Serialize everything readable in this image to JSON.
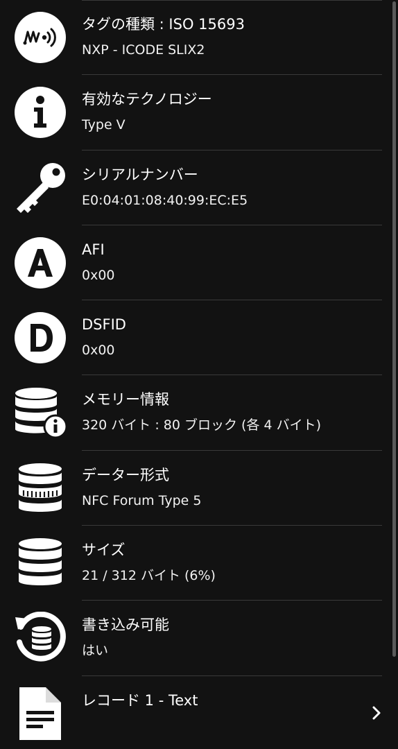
{
  "rows": [
    {
      "icon": "nfc-signal-icon",
      "title": "タグの種類 : ISO 15693",
      "value": "NXP - ICODE SLIX2"
    },
    {
      "icon": "info-icon",
      "title": "有効なテクノロジー",
      "value": "Type V"
    },
    {
      "icon": "key-icon",
      "title": "シリアルナンバー",
      "value": "E0:04:01:08:40:99:EC:E5"
    },
    {
      "icon": "letter-a-icon",
      "title": "AFI",
      "value": "0x00"
    },
    {
      "icon": "letter-d-icon",
      "title": "DSFID",
      "value": "0x00"
    },
    {
      "icon": "database-info-icon",
      "title": "メモリー情報",
      "value": "320 バイト : 80 ブロック (各 4 バイト)"
    },
    {
      "icon": "database-format-icon",
      "title": "データー形式",
      "value": "NFC Forum Type 5"
    },
    {
      "icon": "database-icon",
      "title": "サイズ",
      "value": "21 / 312 バイト (6%)"
    },
    {
      "icon": "database-refresh-icon",
      "title": "書き込み可能",
      "value": "はい"
    },
    {
      "icon": "document-icon",
      "title": "レコード 1 - Text",
      "value": ""
    }
  ],
  "colors": {
    "background": "#121212",
    "text": "#ffffff",
    "divider": "#3a3a3a"
  }
}
